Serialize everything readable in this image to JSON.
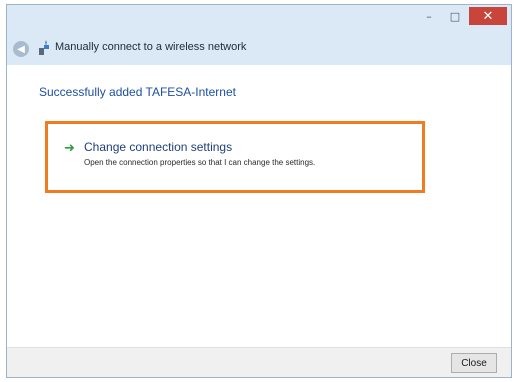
{
  "window": {
    "title": "Manually connect to a wireless network",
    "minimize_glyph": "–",
    "maximize_glyph": "□",
    "close_glyph": "✕"
  },
  "status": {
    "text": "Successfully added TAFESA-Internet"
  },
  "option": {
    "icon": "green-arrow-icon",
    "title": "Change connection settings",
    "description": "Open the connection properties so that I can change the settings.",
    "highlight_color": "#f07b21"
  },
  "footer": {
    "close_label": "Close"
  }
}
